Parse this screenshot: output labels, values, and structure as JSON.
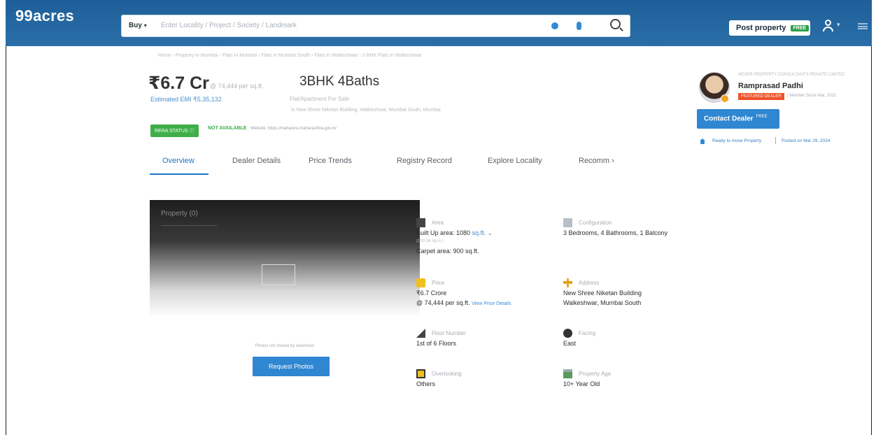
{
  "header": {
    "logo": "99acres",
    "search": {
      "mode": "Buy",
      "placeholder": "Enter Locality / Project / Society / Landmark"
    },
    "post_property": "Post property",
    "post_badge": "FREE",
    "icons": [
      "location-icon",
      "mic-icon",
      "search-icon",
      "user-icon",
      "menu-icon"
    ]
  },
  "listing": {
    "breadcrumb": "Home › Property in Mumbai › Flats in Mumbai › Flats in Mumbai South › Flats in Walkeshwar › 3 BHK Flats in Walkeshwar",
    "price": "₹6.7 Cr",
    "per_sqft": "@ 74,444 per sq.ft.",
    "emi": "Estimated EMI ₹5,35,132",
    "title": "3BHK 4Baths",
    "subtitle": "Flat/Apartment For Sale",
    "location": "in New Shree Niketan Building, Walkeshwar, Mumbai South, Mumbai",
    "rera_label": "RERA STATUS",
    "rera_status": "NOT AVAILABLE",
    "rera_website": "Website: https://maharera.maharashtra.gov.in/"
  },
  "tabs": [
    {
      "label": "Overview"
    },
    {
      "label": "Dealer Details"
    },
    {
      "label": "Price Trends"
    },
    {
      "label": "Registry Record"
    },
    {
      "label": "Explore Locality"
    },
    {
      "label": "Recomm"
    }
  ],
  "photo": {
    "label": "Property (0)",
    "note": "Photos not shared by advertiser",
    "request_button": "Request Photos"
  },
  "details": {
    "area": {
      "label": "Area",
      "built_up": "Built Up area: 1080",
      "unit": "sq.ft.",
      "unit_sub": "(100.34 sq.m.)",
      "carpet": "Carpet area: 900 sq.ft."
    },
    "configuration": {
      "label": "Configuration",
      "value": "3 Bedrooms, 4 Bathrooms, 1 Balcony"
    },
    "price": {
      "label": "Price",
      "value": "₹6.7 Crore",
      "per_sqft": "@ 74,444 per sq.ft.",
      "link": "View Price Details"
    },
    "address": {
      "label": "Address",
      "line1": "New Shree Niketan Building",
      "line2": "Walkeshwar, Mumbai South"
    },
    "floor": {
      "label": "Floor Number",
      "value": "1st of 6 Floors"
    },
    "facing": {
      "label": "Facing",
      "value": "East"
    },
    "overlooking": {
      "label": "Overlooking",
      "value": "Others"
    },
    "age": {
      "label": "Property Age",
      "value": "10+ Year Old"
    }
  },
  "dealer": {
    "role": "NEVER PROPERTY CONSULTANTS PRIVATE LIMITED",
    "name": "Ramprasad Padhi",
    "badge": "FEATURED DEALER",
    "since": "| Member Since Mar, 2021",
    "contact_button": "Contact Dealer",
    "contact_badge": "FREE",
    "ready": "Ready to move Property",
    "posted": "Posted on Mar 29, 2024"
  },
  "colors": {
    "header_blue": "#2a6ea8",
    "accent_blue": "#2f86d1",
    "rera_green": "#3fae49",
    "featured_orange": "#f0522a"
  }
}
